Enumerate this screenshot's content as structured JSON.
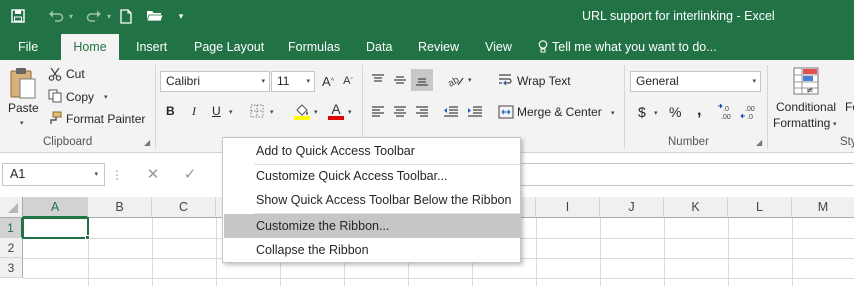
{
  "titlebar": {
    "title": "URL support for interlinking - Excel",
    "qat": [
      {
        "name": "save-icon",
        "glyph": "💾"
      },
      {
        "name": "undo-icon",
        "glyph": "↶"
      },
      {
        "name": "redo-icon",
        "glyph": "↷"
      },
      {
        "name": "new-file-icon",
        "glyph": "🗋"
      },
      {
        "name": "open-folder-icon",
        "glyph": "📂"
      },
      {
        "name": "customize-qat-icon",
        "glyph": "▾"
      }
    ]
  },
  "tabs": [
    {
      "label": "File"
    },
    {
      "label": "Home"
    },
    {
      "label": "Insert"
    },
    {
      "label": "Page Layout"
    },
    {
      "label": "Formulas"
    },
    {
      "label": "Data"
    },
    {
      "label": "Review"
    },
    {
      "label": "View"
    }
  ],
  "tell_me": "Tell me what you want to do...",
  "ribbon": {
    "clipboard": {
      "paste": "Paste",
      "cut": "Cut",
      "copy": "Copy",
      "format_painter": "Format Painter",
      "group_label": "Clipboard"
    },
    "font": {
      "family": "Calibri",
      "size": "11",
      "bold": "B",
      "italic": "I",
      "underline": "U",
      "font_color_letter": "A"
    },
    "alignment": {
      "wrap_text": "Wrap Text",
      "merge_center": "Merge & Center"
    },
    "number": {
      "format": "General",
      "dollar": "$",
      "percent": "%",
      "comma": ",",
      "group_label": "Number"
    },
    "styles": {
      "conditional_line1": "Conditional",
      "conditional_line2": "Formatting",
      "fo": "Fo",
      "sty": "Sty"
    }
  },
  "formula_bar": {
    "name_box": "A1"
  },
  "grid": {
    "columns": [
      "A",
      "B",
      "C",
      "D",
      "E",
      "F",
      "G",
      "H",
      "I",
      "J",
      "K",
      "L",
      "M"
    ],
    "rows": [
      "1",
      "2",
      "3"
    ],
    "selected_cell": "A1"
  },
  "context_menu": {
    "items": [
      {
        "label": "Add to Quick Access Toolbar",
        "highlighted": false
      },
      {
        "label": "Customize Quick Access Toolbar...",
        "highlighted": false
      },
      {
        "label": "Show Quick Access Toolbar Below the Ribbon",
        "highlighted": false
      },
      {
        "label": "Customize the Ribbon...",
        "highlighted": true
      },
      {
        "label": "Collapse the Ribbon",
        "highlighted": false
      }
    ]
  },
  "colors": {
    "accent": "#217346",
    "ribbon_bg": "#f3f3f3",
    "menu_highlight": "#c6c6c6",
    "font_color_bar": "#e00000",
    "fill_color_bar": "#ffff00"
  }
}
